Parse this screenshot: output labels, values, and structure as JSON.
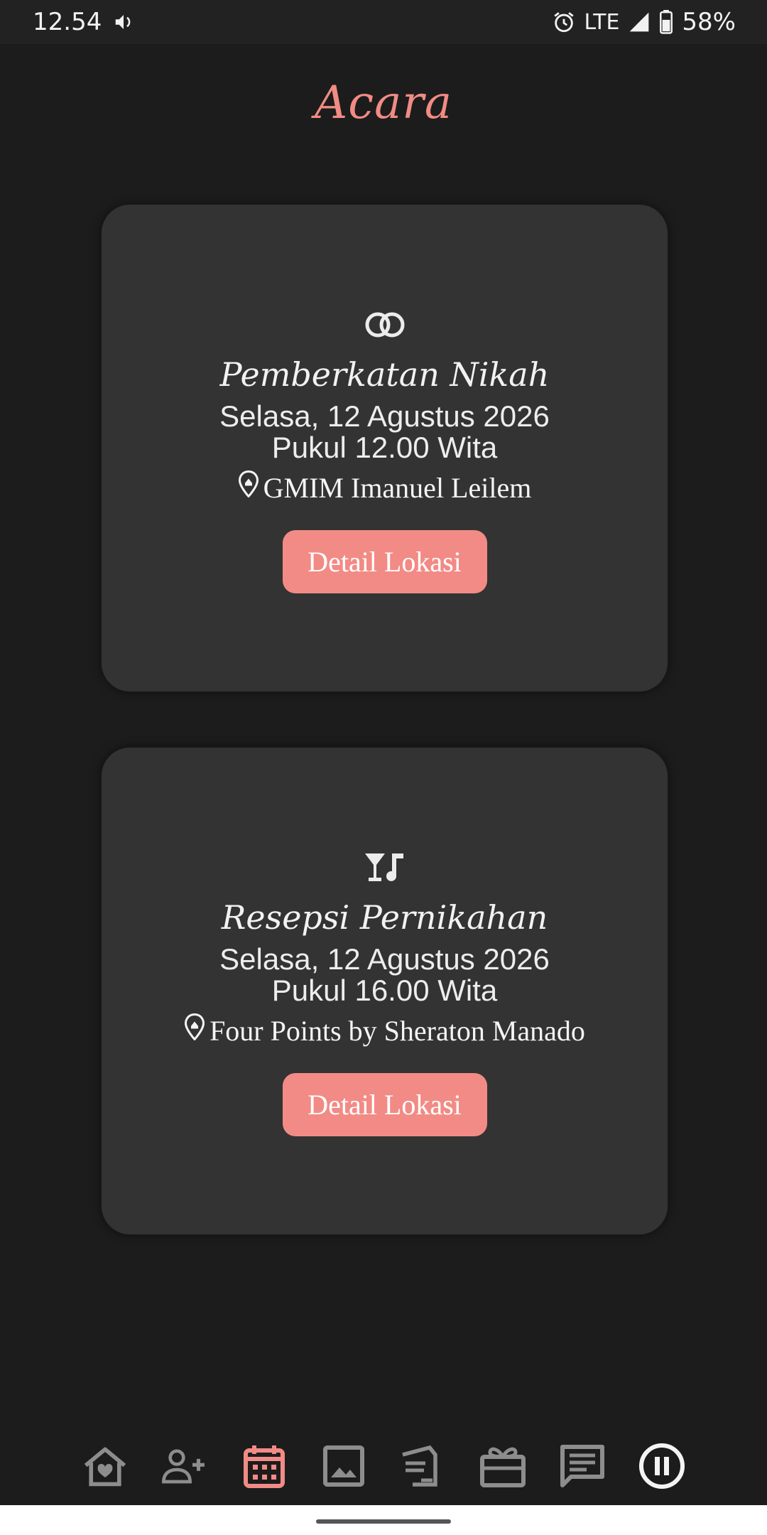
{
  "status_bar": {
    "time": "12.54",
    "network": "LTE",
    "battery": "58%",
    "icons": [
      "volume-icon",
      "alarm-icon",
      "signal-icon",
      "battery-icon"
    ]
  },
  "page": {
    "title": "Acara",
    "accent_color": "#f28b85",
    "background_color": "#1c1c1c",
    "card_color": "#333333"
  },
  "events": [
    {
      "icon": "rings-icon",
      "title": "Pemberkatan Nikah",
      "date": "Selasa, 12 Agustus 2026",
      "time": "Pukul 12.00 Wita",
      "location": "GMIM Imanuel Leilem",
      "button_label": "Detail Lokasi"
    },
    {
      "icon": "cocktail-music-icon",
      "title": "Resepsi Pernikahan",
      "date": "Selasa, 12 Agustus 2026",
      "time": "Pukul 16.00 Wita",
      "location": "Four Points by Sheraton Manado",
      "button_label": "Detail Lokasi"
    }
  ],
  "bottom_nav": {
    "items": [
      "home-heart-icon",
      "add-person-icon",
      "calendar-icon",
      "gallery-icon",
      "love-letter-icon",
      "gift-icon",
      "message-icon",
      "pause-icon"
    ],
    "active": "calendar-icon"
  }
}
